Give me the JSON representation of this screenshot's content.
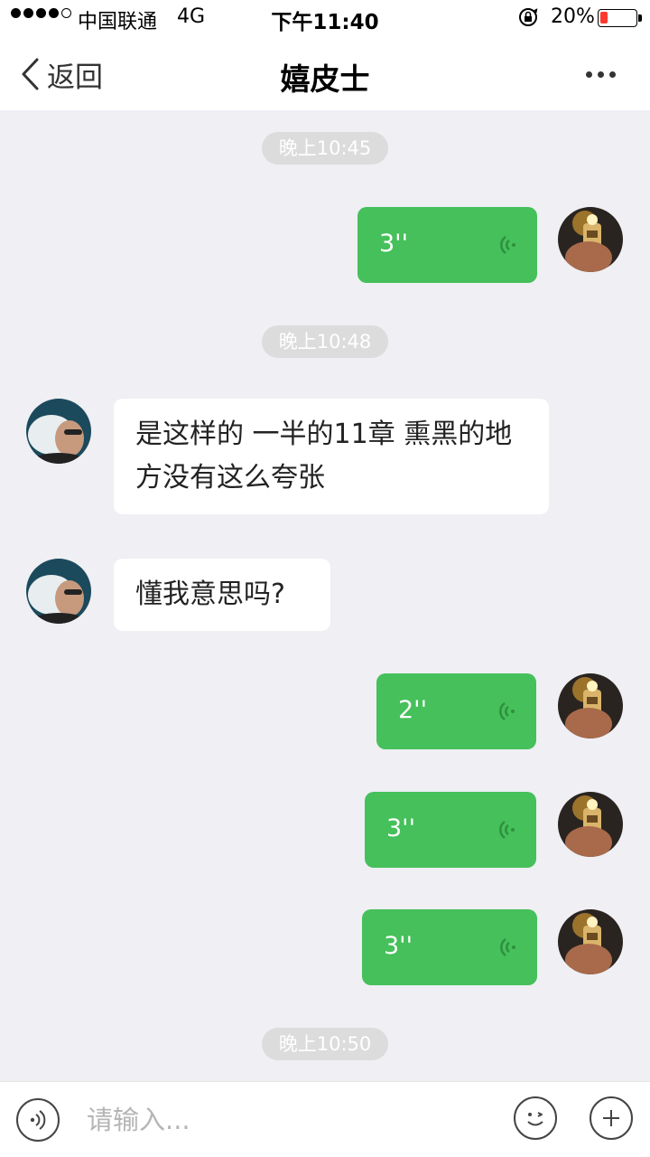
{
  "status_bar": {
    "carrier": "中国联通",
    "network": "4G",
    "time": "下午11:40",
    "battery_percent": "20%",
    "battery_level": 0.2
  },
  "nav": {
    "back_label": "返回",
    "title": "嬉皮士"
  },
  "messages": [
    {
      "type": "timestamp",
      "text": "晚上10:45"
    },
    {
      "type": "voice",
      "side": "right",
      "duration": "3''"
    },
    {
      "type": "timestamp",
      "text": "晚上10:48"
    },
    {
      "type": "text",
      "side": "left",
      "lines": [
        "是这样的 一半的11章 熏黑的地",
        "方没有这么夸张"
      ]
    },
    {
      "type": "text",
      "side": "left",
      "lines": [
        "懂我意思吗?"
      ]
    },
    {
      "type": "voice",
      "side": "right",
      "duration": "2''"
    },
    {
      "type": "voice",
      "side": "right",
      "duration": "3''"
    },
    {
      "type": "voice",
      "side": "right",
      "duration": "3''"
    },
    {
      "type": "timestamp",
      "text": "晚上10:50"
    }
  ],
  "input": {
    "placeholder": "请输入..."
  },
  "colors": {
    "voice_bubble": "#45c05a",
    "text_bubble": "#ffffff",
    "background": "#efeff4",
    "timestamp_bg": "#dcdcdc"
  }
}
